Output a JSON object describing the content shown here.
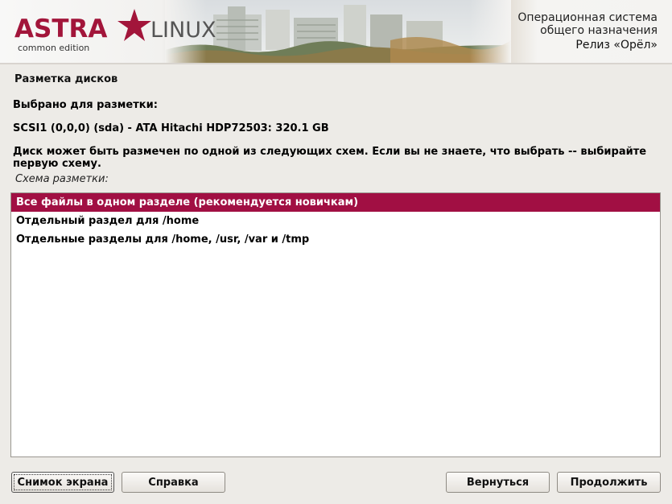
{
  "header": {
    "logo_main": "ASTRA",
    "logo_second": "LINUX",
    "logo_edition": "common edition",
    "product_line1": "Операционная система",
    "product_line2": "общего назначения",
    "release": "Релиз «Орёл»"
  },
  "page": {
    "title": "Разметка дисков",
    "selected_for": "Выбрано для разметки:",
    "disk": "SCSI1 (0,0,0) (sda) - ATA Hitachi HDP72503: 320.1 GB",
    "description": "Диск может быть размечен по одной из следующих схем. Если вы не знаете, что выбрать -- выбирайте первую схему.",
    "list_label": "Схема разметки:"
  },
  "scheme_options": [
    {
      "label": "Все файлы в одном разделе (рекомендуется новичкам)",
      "selected": true
    },
    {
      "label": "Отдельный раздел для /home",
      "selected": false
    },
    {
      "label": "Отдельные разделы для /home, /usr, /var и /tmp",
      "selected": false
    }
  ],
  "buttons": {
    "screenshot": "Снимок экрана",
    "help": "Справка",
    "back": "Вернуться",
    "continue": "Продолжить"
  },
  "colors": {
    "accent": "#a10f43",
    "logo": "#a2153a",
    "background": "#edebe7"
  }
}
